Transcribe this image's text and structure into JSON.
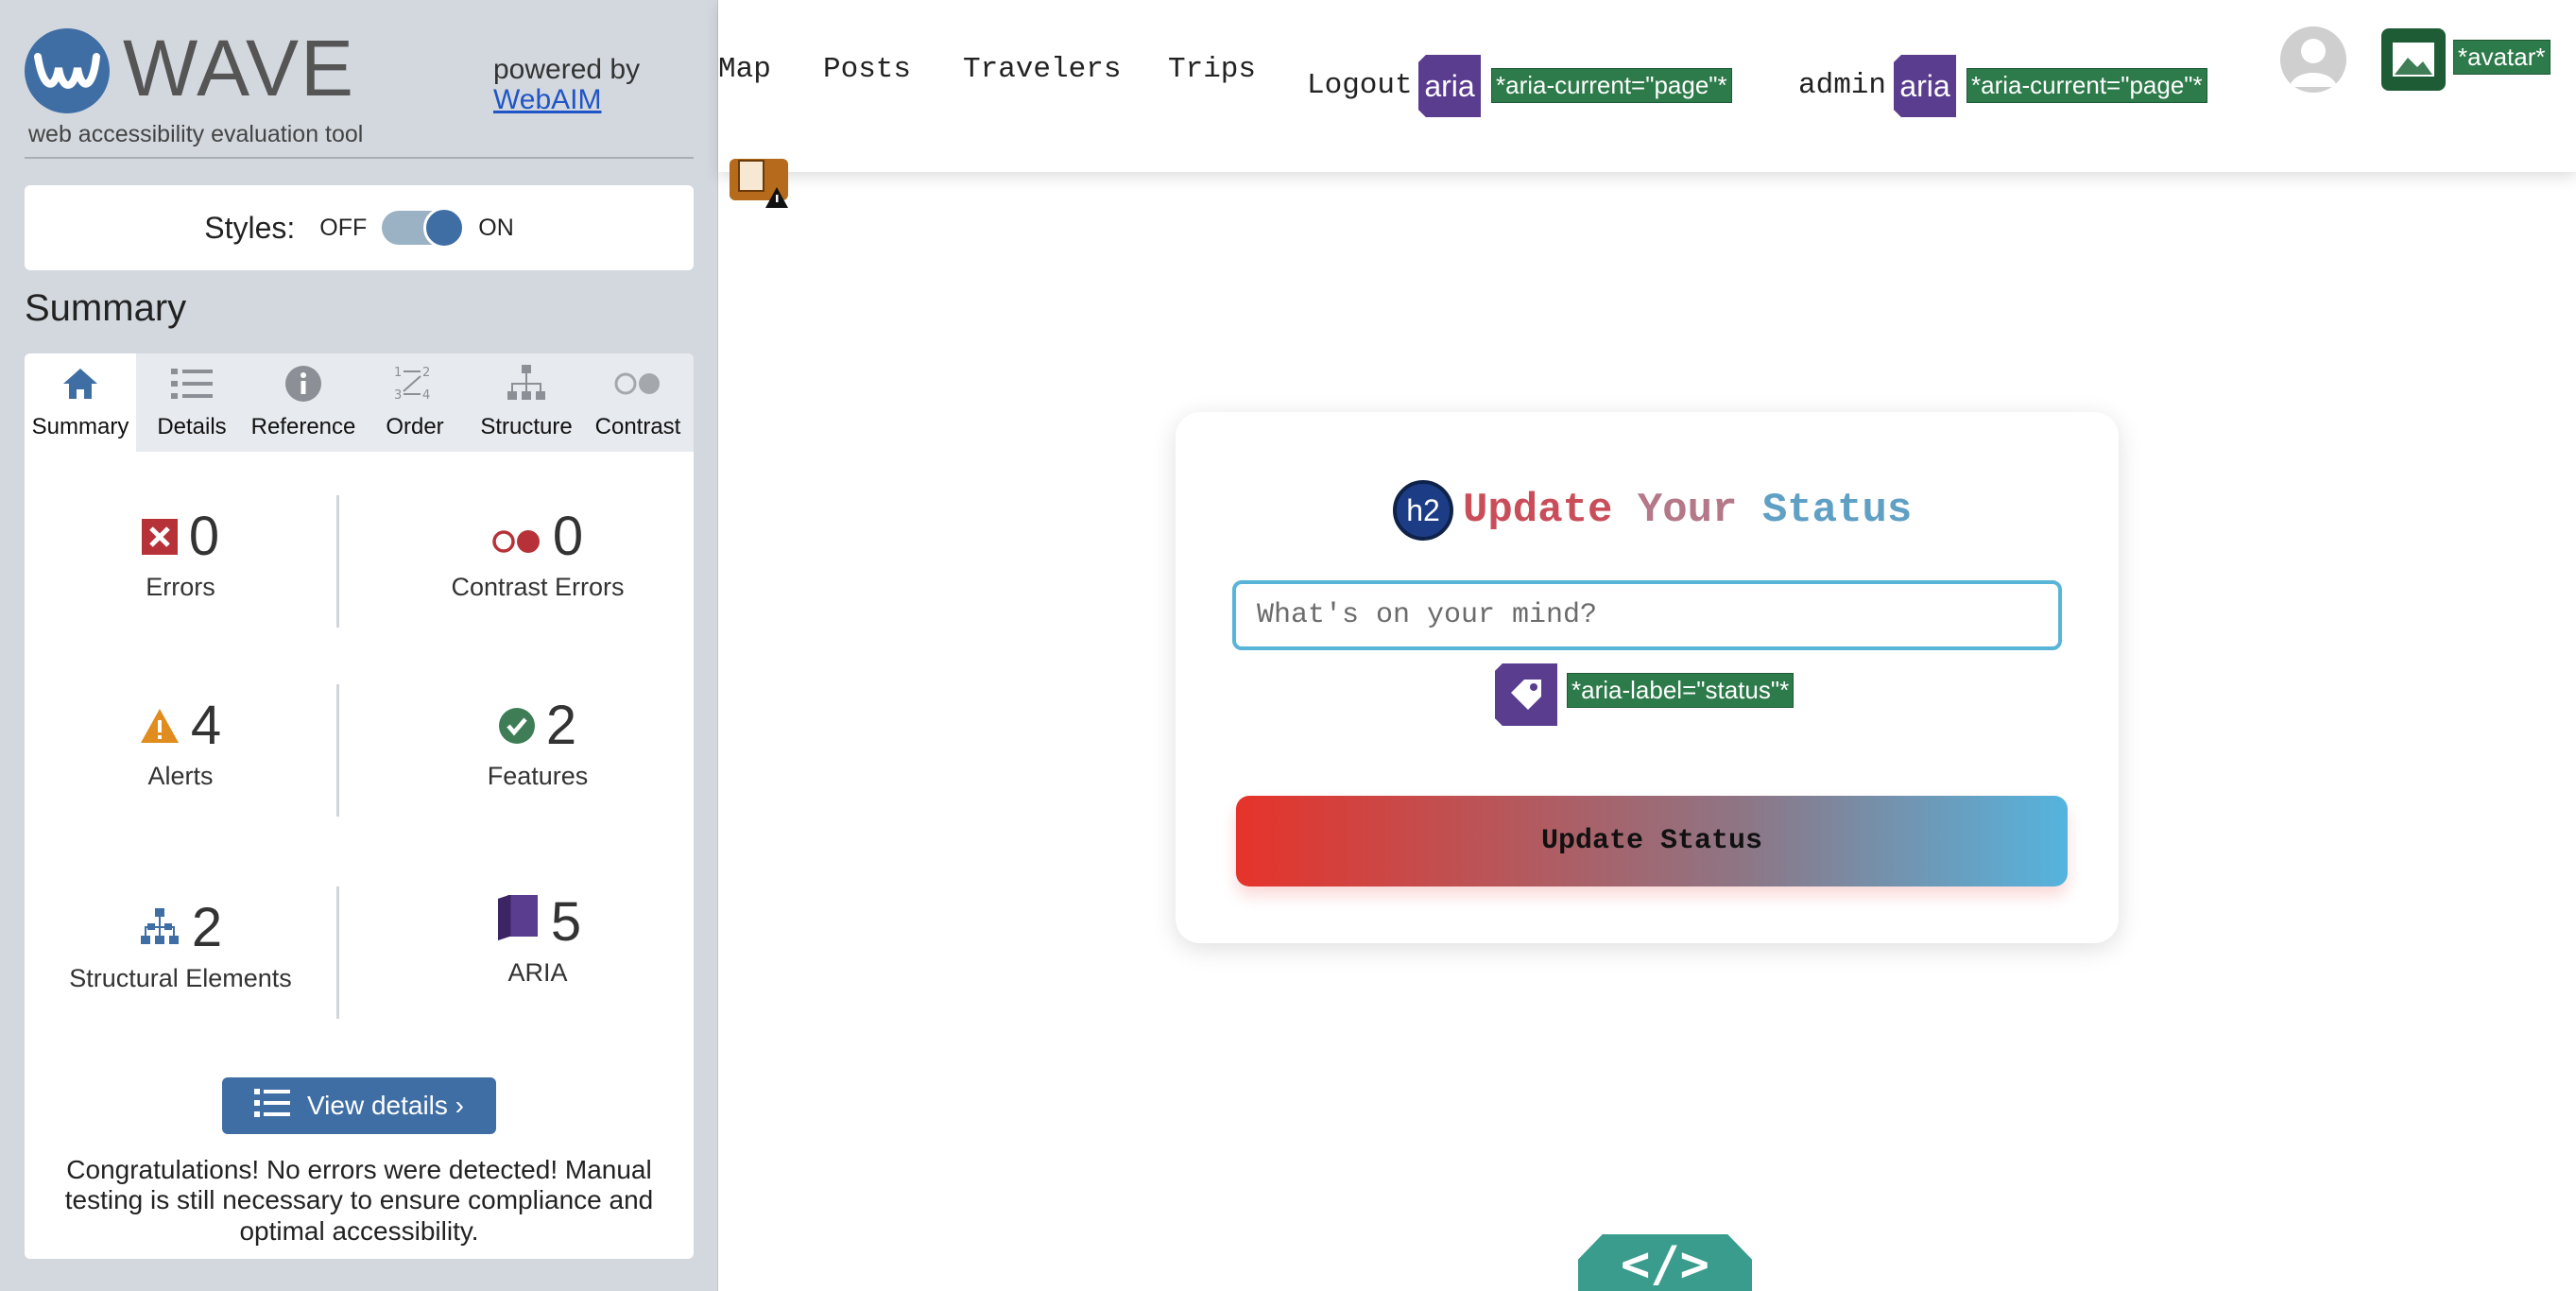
{
  "wave": {
    "title": "WAVE",
    "powered_by": "powered by",
    "webaim_link": "WebAIM",
    "tagline": "web accessibility evaluation tool",
    "styles": {
      "label": "Styles:",
      "off": "OFF",
      "on": "ON",
      "state": "on"
    },
    "summary_heading": "Summary",
    "tabs": [
      {
        "label": "Summary",
        "icon": "home-icon",
        "active": true
      },
      {
        "label": "Details",
        "icon": "list-icon"
      },
      {
        "label": "Reference",
        "icon": "info-icon"
      },
      {
        "label": "Order",
        "icon": "order-icon"
      },
      {
        "label": "Structure",
        "icon": "hierarchy-icon"
      },
      {
        "label": "Contrast",
        "icon": "contrast-icon"
      }
    ],
    "stats": {
      "errors": {
        "count": "0",
        "label": "Errors",
        "icon": "error-x-icon",
        "color": "#b63238"
      },
      "contrast_errors": {
        "count": "0",
        "label": "Contrast Errors",
        "icon": "contrast-icon",
        "color": "#b63238"
      },
      "alerts": {
        "count": "4",
        "label": "Alerts",
        "icon": "alert-triangle-icon",
        "color": "#e08c1f"
      },
      "features": {
        "count": "2",
        "label": "Features",
        "icon": "check-circle-icon",
        "color": "#3e7d55"
      },
      "structural": {
        "count": "2",
        "label": "Structural Elements",
        "icon": "hierarchy-icon",
        "color": "#3f6ea5"
      },
      "aria": {
        "count": "5",
        "label": "ARIA",
        "icon": "aria-cube-icon",
        "color": "#5a3d8f"
      }
    },
    "view_details": "View details ›",
    "congrats": "Congratulations! No errors were detected! Manual testing is still necessary to ensure compliance and optimal accessibility."
  },
  "nav": {
    "links": [
      "Map",
      "Posts",
      "Travelers",
      "Trips"
    ],
    "logout": "Logout",
    "admin": "admin",
    "aria_badge": "aria",
    "aria_current_tag": "*aria-current=\"page\"*",
    "avatar_tag": "*avatar*"
  },
  "card": {
    "h2_badge": "h2",
    "title_words": [
      "Update",
      "Your",
      "Status"
    ],
    "input_placeholder": "What's on your mind?",
    "aria_label_tag": "*aria-label=\"status\"*",
    "button_label": "Update Status"
  },
  "code_badge": "</>",
  "colors": {
    "wave_blue": "#3f6ea5",
    "aria_purple": "#5a3d8f",
    "tag_green": "#2d7a4a",
    "input_border": "#59b5d8",
    "button_gradient_start": "#e6332a",
    "button_gradient_end": "#55b4de"
  }
}
